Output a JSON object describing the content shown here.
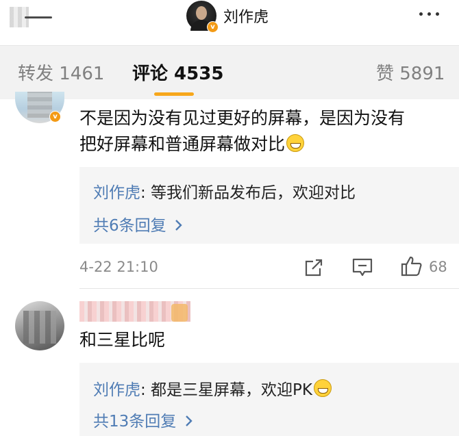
{
  "header": {
    "title": "刘作虎",
    "verified_badge": "v",
    "icons": {
      "back": "back-arrow-icon",
      "more": "more-dots-icon"
    }
  },
  "tabs": {
    "repost": "转发 1461",
    "comments": "评论 4535",
    "likes": "赞 5891",
    "active": "comments",
    "accent_color": "#f7a71b"
  },
  "comments": [
    {
      "text_line1": "不是因为没有见过更好的屏幕，是因为没有",
      "text_line2": "把好屏幕和普通屏幕做对比",
      "emoji": "laughing-emoji",
      "reply": {
        "author": "刘作虎",
        "text": ": 等我们新品发布后，欢迎对比"
      },
      "more_replies": "共6条回复",
      "time": "4-22 21:10",
      "like_count": "68"
    },
    {
      "text": "和三星比呢",
      "reply": {
        "author": "刘作虎",
        "text": ": 都是三星屏幕，欢迎PK"
      },
      "more_replies": "共13条回复"
    }
  ],
  "colors": {
    "link": "#4f7cb4",
    "meta": "#8a8a8a",
    "tab_bg": "#f2f2f2",
    "badge": "#f39a15"
  }
}
